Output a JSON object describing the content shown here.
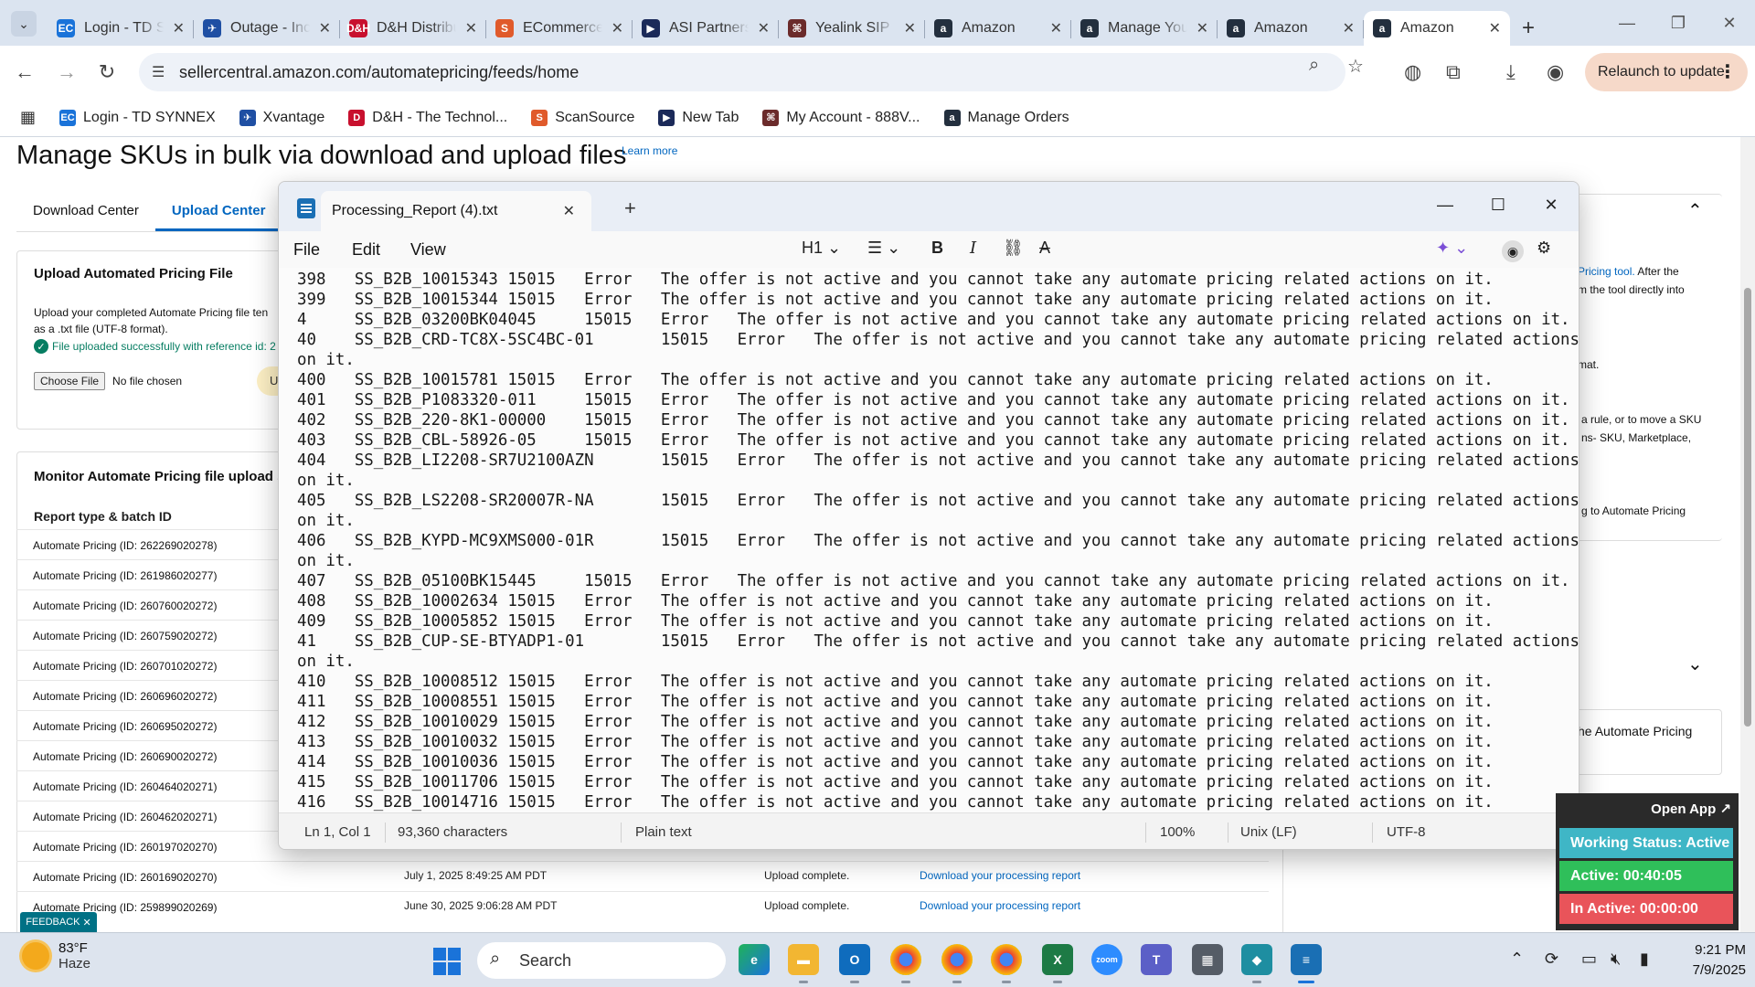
{
  "browser": {
    "tabs": [
      {
        "title": "Login - TD SYNNEX",
        "fav": "EC",
        "color": "#1a73d9"
      },
      {
        "title": "Outage - Incidents",
        "fav": "✈",
        "color": "#1f4fa3"
      },
      {
        "title": "D&H Distributing",
        "fav": "D&H",
        "color": "#c8102e"
      },
      {
        "title": "ECommerce",
        "fav": "S",
        "color": "#e05a2b"
      },
      {
        "title": "ASI Partners",
        "fav": "▶",
        "color": "#1b2a59"
      },
      {
        "title": "Yealink SIP",
        "fav": "⌘",
        "color": "#6b2b2b"
      },
      {
        "title": "Amazon",
        "fav": "a",
        "color": "#232f3e"
      },
      {
        "title": "Manage Your",
        "fav": "a",
        "color": "#232f3e"
      },
      {
        "title": "Amazon",
        "fav": "a",
        "color": "#232f3e"
      },
      {
        "title": "Amazon",
        "fav": "a",
        "color": "#232f3e",
        "active": true
      }
    ],
    "url": "sellercentral.amazon.com/automatepricing/feeds/home",
    "relaunch": "Relaunch to update",
    "bookmarks": [
      {
        "label": "Login - TD SYNNEX",
        "fav": "EC",
        "color": "#1a73d9"
      },
      {
        "label": "Xvantage",
        "fav": "✈",
        "color": "#1f4fa3"
      },
      {
        "label": "D&H - The Technol...",
        "fav": "D",
        "color": "#c8102e"
      },
      {
        "label": "ScanSource",
        "fav": "S",
        "color": "#e05a2b"
      },
      {
        "label": "New Tab",
        "fav": "▶",
        "color": "#1b2a59"
      },
      {
        "label": "My Account - 888V...",
        "fav": "⌘",
        "color": "#6b2b2b"
      },
      {
        "label": "Manage Orders",
        "fav": "a",
        "color": "#232f3e"
      }
    ]
  },
  "page": {
    "title": "Manage SKUs in bulk via download and upload files",
    "learn_more": "Learn more",
    "subtabs": [
      "Download Center",
      "Upload Center"
    ],
    "upload_card": {
      "heading": "Upload Automated Pricing File",
      "line1": "Upload your completed Automate Pricing file ten",
      "line2": "as a .txt file (UTF-8 format).",
      "success": "File uploaded successfully with reference id: 2",
      "choose_file": "Choose File",
      "no_file": "No file chosen",
      "upload_btn_fragment": "U"
    },
    "monitor": {
      "heading": "Monitor Automate Pricing file upload sta",
      "col_header": "Report type & batch ID",
      "rows": [
        "Automate Pricing (ID: 262269020278)",
        "Automate Pricing (ID: 261986020277)",
        "Automate Pricing (ID: 260760020272)",
        "Automate Pricing (ID: 260759020272)",
        "Automate Pricing (ID: 260701020272)",
        "Automate Pricing (ID: 260696020272)",
        "Automate Pricing (ID: 260695020272)",
        "Automate Pricing (ID: 260690020272)",
        "Automate Pricing (ID: 260464020271)",
        "Automate Pricing (ID: 260462020271)",
        "Automate Pricing (ID: 260197020270)",
        "Automate Pricing (ID: 260169020270)",
        "Automate Pricing (ID: 259899020269)"
      ],
      "tail_rows": [
        {
          "date": "July 1, 2025 8:49:25 AM PDT",
          "status": "Upload complete.",
          "link": "Download your processing report"
        },
        {
          "date": "June 30, 2025 9:06:28 AM PDT",
          "status": "Upload complete.",
          "link": "Download your processing report"
        }
      ]
    },
    "right_panel": {
      "t1_link": "Pricing tool.",
      "t1_rest": "After the",
      "t2": "m the tool directly into",
      "t3": "mat.",
      "t4": "a rule, or to move a SKU",
      "t5": "ns- SKU, Marketplace,",
      "t6": "g to Automate Pricing",
      "t7": "he Automate Pricing"
    },
    "feedback": "FEEDBACK"
  },
  "notepad": {
    "tab_title": "Processing_Report (4).txt",
    "menus": [
      "File",
      "Edit",
      "View"
    ],
    "heading_btn": "H1",
    "lines": [
      "398   SS_B2B_10015343 15015   Error   The offer is not active and you cannot take any automate pricing related actions on it.",
      "399   SS_B2B_10015344 15015   Error   The offer is not active and you cannot take any automate pricing related actions on it.",
      "4     SS_B2B_03200BK04045     15015   Error   The offer is not active and you cannot take any automate pricing related actions on it.",
      "40    SS_B2B_CRD-TC8X-5SC4BC-01       15015   Error   The offer is not active and you cannot take any automate pricing related actions",
      "on it.",
      "400   SS_B2B_10015781 15015   Error   The offer is not active and you cannot take any automate pricing related actions on it.",
      "401   SS_B2B_P1083320-011     15015   Error   The offer is not active and you cannot take any automate pricing related actions on it.",
      "402   SS_B2B_220-8K1-00000    15015   Error   The offer is not active and you cannot take any automate pricing related actions on it.",
      "403   SS_B2B_CBL-58926-05     15015   Error   The offer is not active and you cannot take any automate pricing related actions on it.",
      "404   SS_B2B_LI2208-SR7U2100AZN       15015   Error   The offer is not active and you cannot take any automate pricing related actions",
      "on it.",
      "405   SS_B2B_LS2208-SR20007R-NA       15015   Error   The offer is not active and you cannot take any automate pricing related actions",
      "on it.",
      "406   SS_B2B_KYPD-MC9XMS000-01R       15015   Error   The offer is not active and you cannot take any automate pricing related actions",
      "on it.",
      "407   SS_B2B_05100BK15445     15015   Error   The offer is not active and you cannot take any automate pricing related actions on it.",
      "408   SS_B2B_10002634 15015   Error   The offer is not active and you cannot take any automate pricing related actions on it.",
      "409   SS_B2B_10005852 15015   Error   The offer is not active and you cannot take any automate pricing related actions on it.",
      "41    SS_B2B_CUP-SE-BTYADP1-01        15015   Error   The offer is not active and you cannot take any automate pricing related actions",
      "on it.",
      "410   SS_B2B_10008512 15015   Error   The offer is not active and you cannot take any automate pricing related actions on it.",
      "411   SS_B2B_10008551 15015   Error   The offer is not active and you cannot take any automate pricing related actions on it.",
      "412   SS_B2B_10010029 15015   Error   The offer is not active and you cannot take any automate pricing related actions on it.",
      "413   SS_B2B_10010032 15015   Error   The offer is not active and you cannot take any automate pricing related actions on it.",
      "414   SS_B2B_10010036 15015   Error   The offer is not active and you cannot take any automate pricing related actions on it.",
      "415   SS_B2B_10011706 15015   Error   The offer is not active and you cannot take any automate pricing related actions on it.",
      "416   SS_B2B_10014716 15015   Error   The offer is not active and you cannot take any automate pricing related actions on it."
    ],
    "status": {
      "position": "Ln 1, Col 1",
      "chars": "93,360 characters",
      "format": "Plain text",
      "zoom": "100%",
      "eol": "Unix (LF)",
      "encoding": "UTF-8"
    }
  },
  "work_status": {
    "open_app": "Open App ↗",
    "status": "Working Status: Active",
    "active": "Active: 00:40:05",
    "inactive": "In Active: 00:00:00",
    "colors": {
      "status": "#3fb6c6",
      "active": "#2fbf5a",
      "inactive": "#e9545a"
    }
  },
  "taskbar": {
    "temp": "83°F",
    "condition": "Haze",
    "search": "Search",
    "time": "9:21 PM",
    "date": "7/9/2025"
  }
}
